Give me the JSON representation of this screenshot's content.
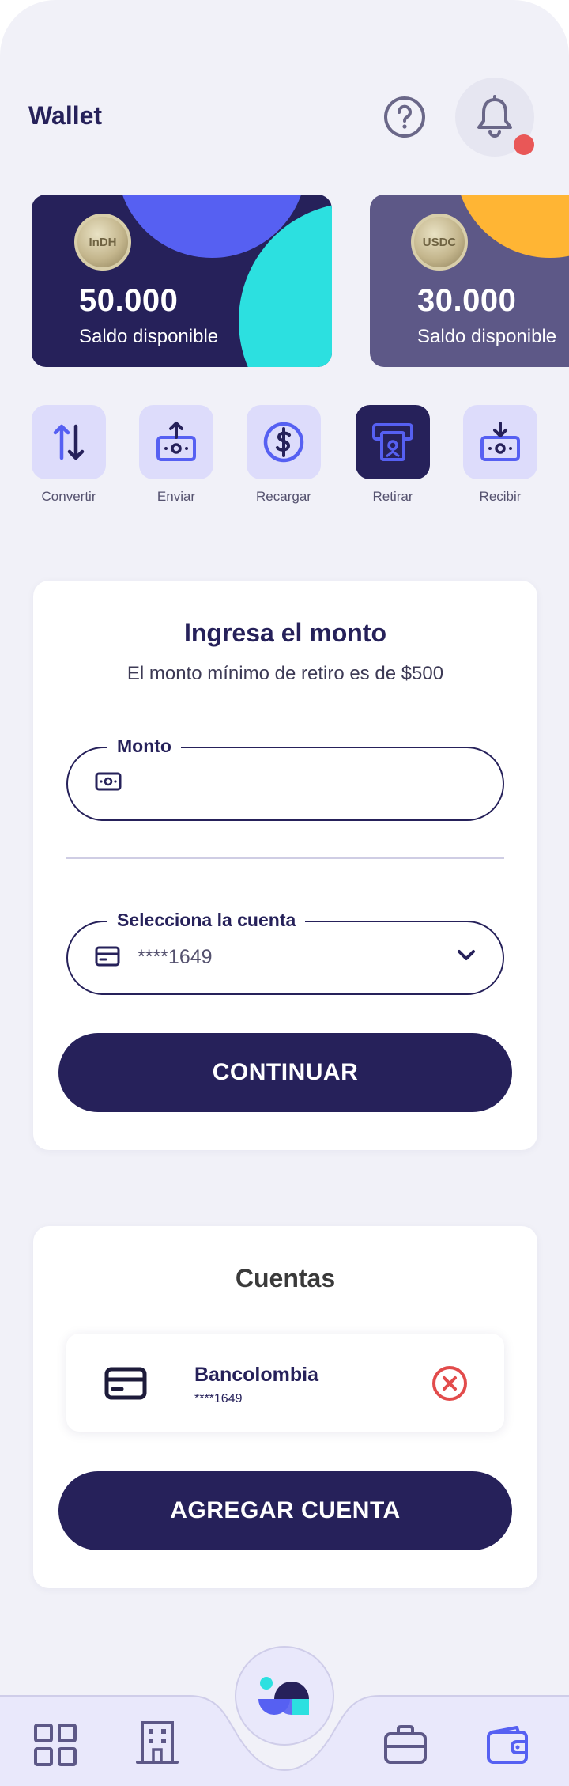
{
  "header": {
    "title": "Wallet"
  },
  "cards": [
    {
      "coin": "InDH",
      "amount": "50.000",
      "label": "Saldo disponible"
    },
    {
      "coin": "USDC",
      "amount": "30.000",
      "label": "Saldo disponible"
    }
  ],
  "actions": [
    {
      "label": "Convertir",
      "icon": "swap-icon"
    },
    {
      "label": "Enviar",
      "icon": "send-money-icon"
    },
    {
      "label": "Recargar",
      "icon": "dollar-coin-icon"
    },
    {
      "label": "Retirar",
      "icon": "atm-withdraw-icon"
    },
    {
      "label": "Recibir",
      "icon": "receive-money-icon"
    }
  ],
  "withdraw": {
    "title": "Ingresa el monto",
    "subtitle": "El monto mínimo de retiro es de $500",
    "amount_label": "Monto",
    "amount_value": "",
    "account_label": "Selecciona la cuenta",
    "account_value": "****1649",
    "continue_label": "CONTINUAR"
  },
  "accounts": {
    "title": "Cuentas",
    "items": [
      {
        "bank": "Bancolombia",
        "number": "****1649"
      }
    ],
    "add_label": "AGREGAR CUENTA"
  },
  "colors": {
    "primary": "#26215a",
    "accent_blue": "#5660f2",
    "accent_cyan": "#2ce0e0",
    "accent_yellow": "#ffb534",
    "tile": "#dddcfb",
    "danger": "#e24b4b"
  }
}
